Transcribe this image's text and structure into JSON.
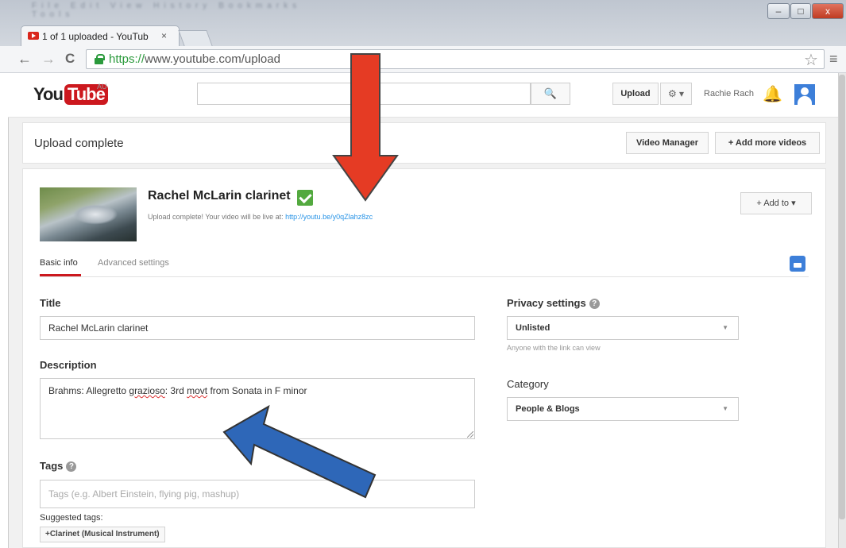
{
  "browser": {
    "tab_title": "1 of 1 uploaded - YouTub",
    "tab_close": "×",
    "titlebar_blurred": "File Edit View History Bookmarks Tools",
    "url_scheme": "https://",
    "url_rest": "www.youtube.com/upload",
    "window_controls": {
      "minimize": "–",
      "maximize": "□",
      "close": "x"
    },
    "nav_back": "←",
    "nav_forward": "→",
    "nav_reload": "C",
    "star": "☆",
    "menu": "≡"
  },
  "masthead": {
    "logo_you": "You",
    "logo_tube": "Tube",
    "region": "AU",
    "search_placeholder": "",
    "search_icon": "🔍",
    "upload_label": "Upload",
    "settings_label": "⚙ ▾",
    "username": "Rachie Rach",
    "bell_icon": "🔔"
  },
  "status_bar": {
    "text": "Upload complete",
    "video_manager_label": "Video Manager",
    "add_more_label": "+ Add more videos"
  },
  "video": {
    "title": "Rachel McLarin clarinet",
    "upload_message": "Upload complete! Your video will be live at: ",
    "link": "http://youtu.be/y0qZlahz8zc",
    "add_to_label": "+ Add to ▾"
  },
  "tabs": {
    "basic": "Basic info",
    "advanced": "Advanced settings"
  },
  "form": {
    "title_label": "Title",
    "title_value": "Rachel McLarin   clarinet",
    "description_label": "Description",
    "description_before": "Brahms: Allegretto ",
    "description_word1": "grazioso",
    "description_mid": ": 3rd ",
    "description_word2": "movt",
    "description_after": " from Sonata in F minor",
    "tags_label": "Tags",
    "tags_placeholder": "Tags (e.g. Albert Einstein, flying pig, mashup)",
    "suggested_label": "Suggested tags:",
    "suggested_tag": "+Clarinet (Musical Instrument)",
    "help_glyph": "?",
    "privacy_label": "Privacy settings",
    "privacy_value": "Unlisted",
    "privacy_help": "Anyone with the link can view",
    "category_label": "Category",
    "category_value": "People & Blogs",
    "dropdown_glyph": "▼"
  },
  "colors": {
    "youtube_red": "#cc181e",
    "annotation_red": "#e53b24",
    "annotation_blue": "#2e67b8",
    "link_blue": "#2793e6",
    "check_green": "#53a93f"
  }
}
